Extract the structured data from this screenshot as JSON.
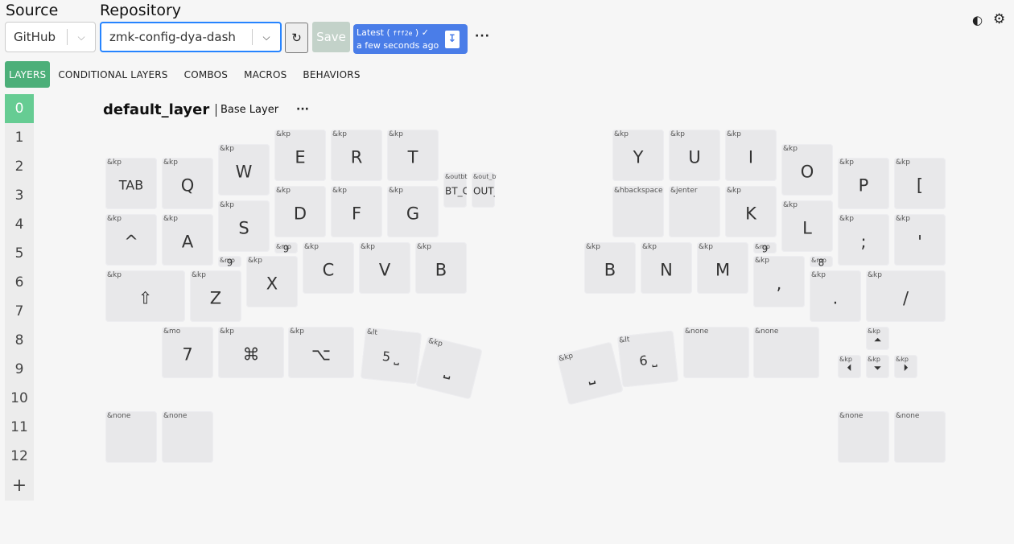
{
  "header": {
    "source_label": "Source",
    "source_value": "GitHub",
    "repo_label": "Repository",
    "repo_value": "zmk-config-dya-dash",
    "save_label": "Save",
    "latest_label": "Latest",
    "commit_hash": "fff2e",
    "commit_check": "✓",
    "commit_time": "a few seconds ago"
  },
  "tabs": [
    "LAYERS",
    "CONDITIONAL LAYERS",
    "COMBOS",
    "MACROS",
    "BEHAVIORS"
  ],
  "layers": [
    "0",
    "1",
    "2",
    "3",
    "4",
    "5",
    "6",
    "7",
    "8",
    "9",
    "10",
    "11",
    "12"
  ],
  "layer_add": "+",
  "layer": {
    "name": "default_layer",
    "label": "Base Layer"
  },
  "keys": [
    {
      "b": "&kp",
      "l": "TAB"
    },
    {
      "b": "&kp",
      "l": "Q"
    },
    {
      "b": "&kp",
      "l": "W"
    },
    {
      "b": "&kp",
      "l": "E"
    },
    {
      "b": "&kp",
      "l": "R"
    },
    {
      "b": "&kp",
      "l": "T"
    },
    {
      "b": "&kp",
      "l": "^"
    },
    {
      "b": "&kp",
      "l": "A"
    },
    {
      "b": "&kp",
      "l": "S"
    },
    {
      "b": "&kp",
      "l": "D"
    },
    {
      "b": "&kp",
      "l": "F"
    },
    {
      "b": "&kp",
      "l": "G"
    },
    {
      "b": "&outbt",
      "l": "BT_CLR_CI"
    },
    {
      "b": "&out_bt_nxt",
      "l": "OUT_TOG"
    },
    {
      "b": "&kp",
      "l": "⇧"
    },
    {
      "b": "&kp",
      "l": "Z"
    },
    {
      "b": "&mo",
      "l": "9"
    },
    {
      "b": "&kp",
      "l": "X"
    },
    {
      "b": "&mo",
      "l": "9"
    },
    {
      "b": "&kp",
      "l": "C"
    },
    {
      "b": "&kp",
      "l": "V"
    },
    {
      "b": "&kp",
      "l": "B"
    },
    {
      "b": "&mo",
      "l": "7"
    },
    {
      "b": "&kp",
      "l": "⌘"
    },
    {
      "b": "&kp",
      "l": "⌥"
    },
    {
      "b": "&lt",
      "l": "5 ⎵"
    },
    {
      "b": "&kp",
      "l": "⎵"
    },
    {
      "b": "&kp",
      "l": "Y"
    },
    {
      "b": "&kp",
      "l": "U"
    },
    {
      "b": "&kp",
      "l": "I"
    },
    {
      "b": "&kp",
      "l": "O"
    },
    {
      "b": "&kp",
      "l": "P"
    },
    {
      "b": "&kp",
      "l": "["
    },
    {
      "b": "&hbackspace",
      "l": ""
    },
    {
      "b": "&jenter",
      "l": ""
    },
    {
      "b": "&kp",
      "l": "K"
    },
    {
      "b": "&kp",
      "l": "L"
    },
    {
      "b": "&kp",
      "l": ";"
    },
    {
      "b": "&kp",
      "l": "'"
    },
    {
      "b": "&kp",
      "l": "B"
    },
    {
      "b": "&kp",
      "l": "N"
    },
    {
      "b": "&kp",
      "l": "M"
    },
    {
      "b": "&mo",
      "l": "9"
    },
    {
      "b": "&mo",
      "l": "8"
    },
    {
      "b": "&kp",
      "l": ","
    },
    {
      "b": "&kp",
      "l": "."
    },
    {
      "b": "&kp",
      "l": "/"
    },
    {
      "b": "&kp",
      "l": "⎵"
    },
    {
      "b": "&lt",
      "l": "6 ⎵"
    },
    {
      "b": "&none",
      "l": ""
    },
    {
      "b": "&none",
      "l": ""
    },
    {
      "b": "&kp",
      "l": "⏶"
    },
    {
      "b": "&kp",
      "l": "⏴"
    },
    {
      "b": "&kp",
      "l": "⏷"
    },
    {
      "b": "&kp",
      "l": "⏵"
    },
    {
      "b": "&none",
      "l": ""
    },
    {
      "b": "&none",
      "l": ""
    },
    {
      "b": "&none",
      "l": ""
    },
    {
      "b": "&none",
      "l": ""
    }
  ]
}
